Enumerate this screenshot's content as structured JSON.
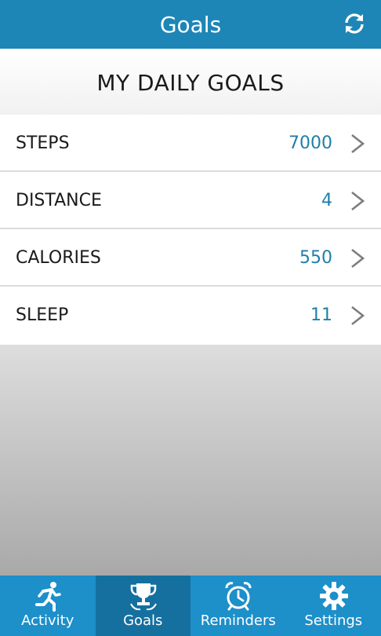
{
  "app": {
    "title": "Goals"
  },
  "header": {
    "title": "MY DAILY GOALS"
  },
  "goals": [
    {
      "label": "STEPS",
      "value": "7000"
    },
    {
      "label": "DISTANCE",
      "value": "4"
    },
    {
      "label": "CALORIES",
      "value": "550"
    },
    {
      "label": "SLEEP",
      "value": "11"
    }
  ],
  "tabs": [
    {
      "label": "Activity",
      "icon": "running-person-icon"
    },
    {
      "label": "Goals",
      "icon": "trophy-icon",
      "active": true
    },
    {
      "label": "Reminders",
      "icon": "alarm-clock-icon"
    },
    {
      "label": "Settings",
      "icon": "gear-icon"
    }
  ],
  "colors": {
    "topbar": "#1d86b6",
    "tabbar": "#1d8fc9",
    "tab_active": "#15709f",
    "value_text": "#1e7fa8"
  }
}
